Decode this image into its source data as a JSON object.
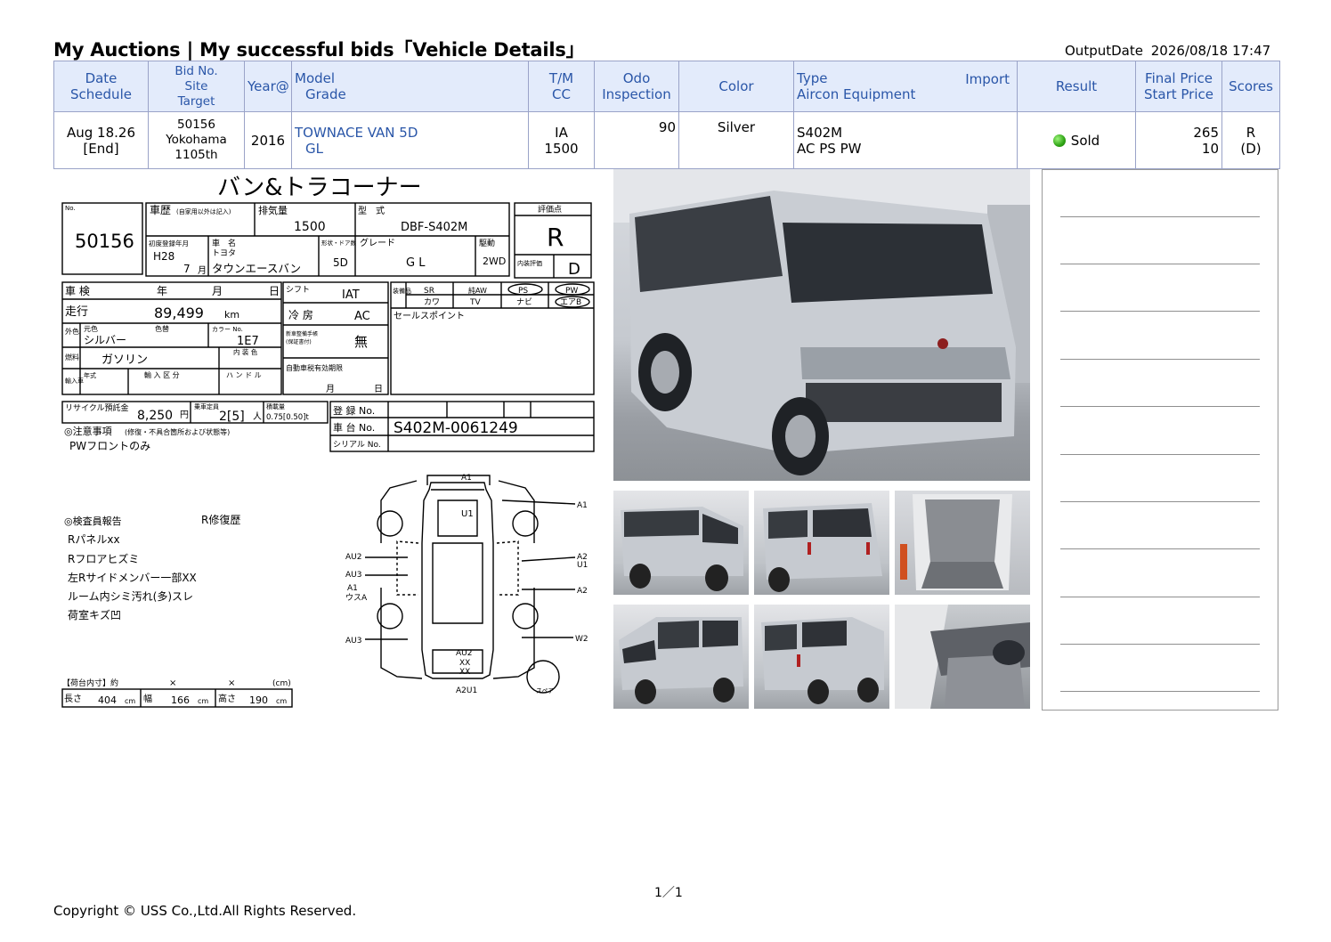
{
  "header": {
    "title": "My Auctions | My successful bids「Vehicle Details」",
    "output_label": "OutputDate",
    "output_value": "2026/08/18 17:47"
  },
  "table": {
    "headers": {
      "date": "Date",
      "schedule": "Schedule",
      "bidno": "Bid No.",
      "site": "Site",
      "target": "Target",
      "year": "Year@",
      "model": "Model",
      "grade": "Grade",
      "tm": "T/M",
      "cc": "CC",
      "odo": "Odo",
      "inspection": "Inspection",
      "color": "Color",
      "type": "Type",
      "import": "Import",
      "aircon": "Aircon Equipment",
      "result": "Result",
      "final_price": "Final Price",
      "start_price": "Start Price",
      "scores": "Scores"
    },
    "row": {
      "date": "Aug 18.26",
      "schedule": "[End]",
      "bidno": "50156",
      "site": "Yokohama",
      "target": "1105th",
      "year": "2016",
      "model": "TOWNACE VAN 5D",
      "grade": "GL",
      "tm": "IA",
      "cc": "1500",
      "odo": "90",
      "color": "Silver",
      "type": "S402M",
      "aircon": "AC PS PW",
      "result": "Sold",
      "final_price": "265",
      "start_price": "10",
      "score": "R",
      "score_sub": "(D)"
    }
  },
  "sheet": {
    "heading": "バン&トラコーナー",
    "lot_label": "No.",
    "lot_no": "50156",
    "history_label": "車歴",
    "history_note": "(自家用以外は記入)",
    "displacement_label": "排気量",
    "displacement": "1500",
    "model_code_label": "型　式",
    "model_code": "DBF-S402M",
    "grade_label_eval": "評価点",
    "eval": "R",
    "first_reg_label": "初度登録年月",
    "first_reg_era": "H28",
    "first_reg_month": "7",
    "month_suffix": "月",
    "car_name_label": "車　名",
    "maker": "トヨタ",
    "car_name": "タウンエースバン",
    "doors_label": "形状・ドア数",
    "doors": "5D",
    "grade_label": "グレード",
    "grade": "G L",
    "drive_label": "駆動",
    "drive": "2WD",
    "interior_label": "内装評価",
    "interior": "D",
    "shaken_label": "車 検",
    "year_char": "年",
    "month_char": "月",
    "day_char": "日",
    "shift_label": "シフト",
    "shift": "IAT",
    "equip_label": "装備品",
    "equip_sr": "SR",
    "equip_aw": "純AW",
    "equip_ps": "PS",
    "equip_pw": "PW",
    "equip_kawa": "カワ",
    "equip_tv": "TV",
    "equip_navi": "ナビ",
    "equip_airbag": "エアB",
    "mileage_label": "走行",
    "mileage": "89,499",
    "mileage_unit": "km",
    "ac_label": "冷 房",
    "ac": "AC",
    "sales_point_label": "セールスポイント",
    "ext_color_label": "外色",
    "orig_color_label": "元色",
    "color_change_label": "色替",
    "color_label_code": "カラー No.",
    "ext_color": "シルバー",
    "color_code": "1E7",
    "interior_color_label": "内 装 色",
    "manual_label": "新車整備手帳",
    "manual_sub": "(保証書付)",
    "manual": "無",
    "fuel_label": "燃料",
    "fuel": "ガソリン",
    "import_label": "輸入車",
    "import_year_label": "年式",
    "import_class_label": "輸 入 区 分",
    "handle_label": "ハ ン ド ル",
    "tax_label": "自動車税有効期限",
    "recycle_label": "リサイクル預託金",
    "recycle": "8,250",
    "yen": "円",
    "capacity_label": "乗車定員",
    "capacity": "2[5]",
    "person": "人",
    "load_label": "積載量",
    "load": "0.75[0.50]t",
    "reg_label": "登 録 No.",
    "chassis_label": "車 台 No.",
    "chassis": "S402M-0061249",
    "serial_label": "シリアル No.",
    "caution_label": "◎注意事項",
    "caution_note": "(修復・不具合箇所および状態等)",
    "caution_text": "PWフロントのみ",
    "inspector_label": "◎検査員報告",
    "repair_label": "R修復歴",
    "report_lines": [
      "Rパネルxx",
      "Rフロアヒズミ",
      "左Rサイドメンバー一部XX",
      "ルーム内シミ汚れ(多)スレ",
      "荷室キズ凹"
    ],
    "cargo_label": "【荷台内寸】約",
    "cargo_x": "×",
    "cargo_unit": "(cm)",
    "length_label": "長さ",
    "length": "404",
    "width_label": "幅",
    "width": "166",
    "height_label": "高さ",
    "height": "190",
    "cm": "cm",
    "marks": {
      "a1_top": "A1",
      "u1": "U1",
      "a1_right": "A1",
      "a2u1": "A2\nU1",
      "a2_right": "A2",
      "au2_left": "AU2",
      "au3_left": "AU3",
      "a1_left": "A1",
      "usua": "ウスA",
      "au3_low": "AU3",
      "w2": "W2",
      "au2_bottom": "AU2",
      "xx1": "XX",
      "xx2": "XX",
      "a2u1_bottom": "A2U1",
      "spare": "スペア"
    }
  },
  "footer": {
    "page": "1／1",
    "copyright": "Copyright © USS Co.,Ltd.All Rights Reserved."
  },
  "colors": {
    "header_bg": "#e3ebfb",
    "header_text": "#2a56a8",
    "border": "#9aa3c8",
    "sold_dot": "#2fa315",
    "car_silver": "#c9cdd3"
  }
}
